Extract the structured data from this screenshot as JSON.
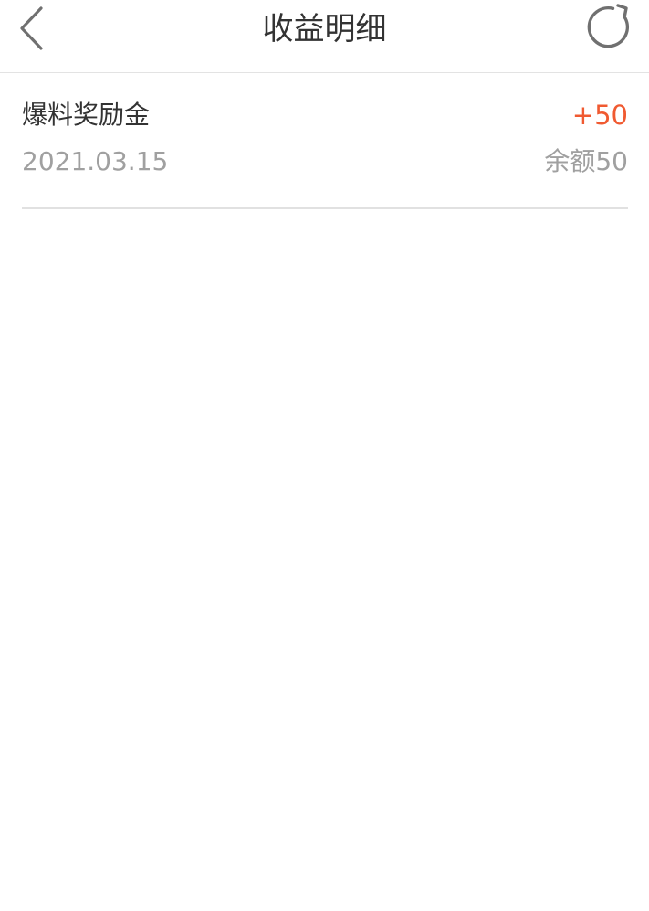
{
  "header": {
    "title": "收益明细",
    "back_icon": "chevron-left-icon",
    "refresh_icon": "refresh-icon"
  },
  "records": [
    {
      "title": "爆料奖励金",
      "amount": "+50",
      "date": "2021.03.15",
      "balance": "余额50"
    }
  ],
  "colors": {
    "amount_positive": "#f05a31",
    "secondary_text": "#a0a0a0",
    "primary_text": "#333333",
    "divider": "#e1e1e1"
  }
}
